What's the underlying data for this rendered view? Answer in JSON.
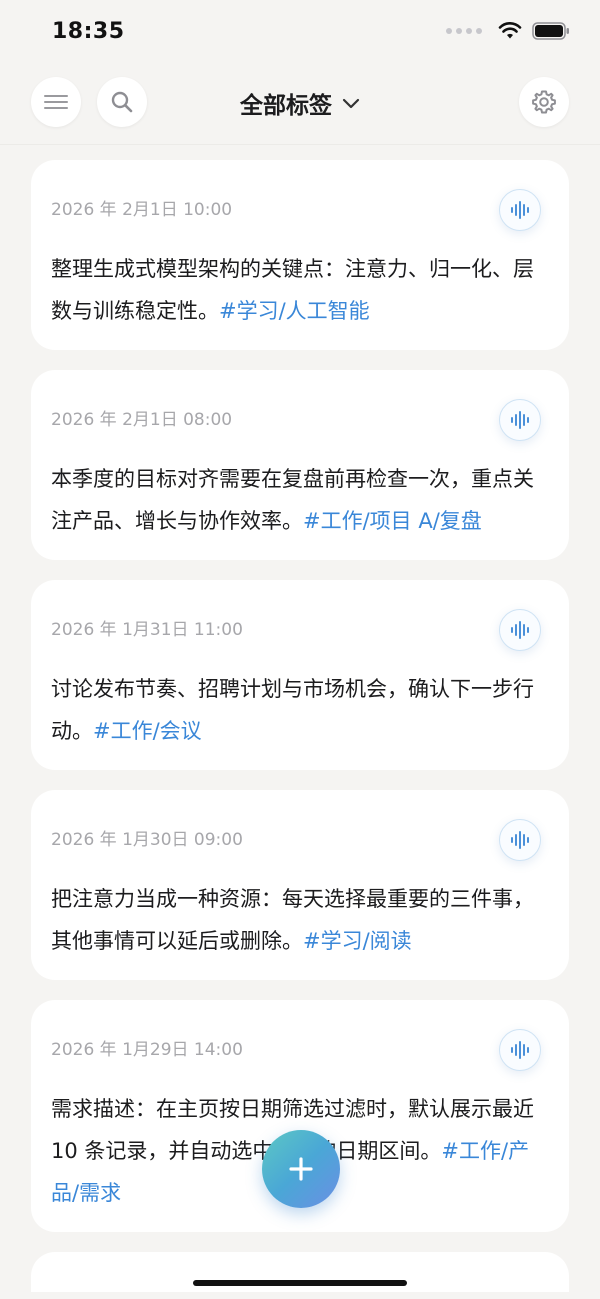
{
  "status_bar": {
    "time": "18:35"
  },
  "header": {
    "title": "全部标签"
  },
  "notes": [
    {
      "date": "2026 年 2月1日 10:00",
      "text": "整理生成式模型架构的关键点：注意力、归一化、层数与训练稳定性。",
      "tag": "#学习/人工智能"
    },
    {
      "date": "2026 年 2月1日 08:00",
      "text": "本季度的目标对齐需要在复盘前再检查一次，重点关注产品、增长与协作效率。",
      "tag": "#工作/项目 A/复盘"
    },
    {
      "date": "2026 年 1月31日 11:00",
      "text": "讨论发布节奏、招聘计划与市场机会，确认下一步行动。",
      "tag": "#工作/会议"
    },
    {
      "date": "2026 年 1月30日 09:00",
      "text": "把注意力当成一种资源：每天选择最重要的三件事，其他事情可以延后或删除。",
      "tag": "#学习/阅读"
    },
    {
      "date": "2026 年 1月29日 14:00",
      "text": "需求描述：在主页按日期筛选过滤时，默认展示最近 10 条记录，并自动选中对应的日期区间。",
      "tag": "#工作/产品/需求"
    }
  ],
  "colors": {
    "background": "#f5f4f2",
    "tag": "#3a87d8",
    "fab_gradient_start": "#5cc8c4",
    "fab_gradient_end": "#6b8fe4"
  },
  "icons": {
    "menu": "menu-icon",
    "search": "search-icon",
    "settings": "gear-icon",
    "dropdown": "chevron-down-icon",
    "voice": "waveform-icon",
    "add": "plus-icon"
  }
}
